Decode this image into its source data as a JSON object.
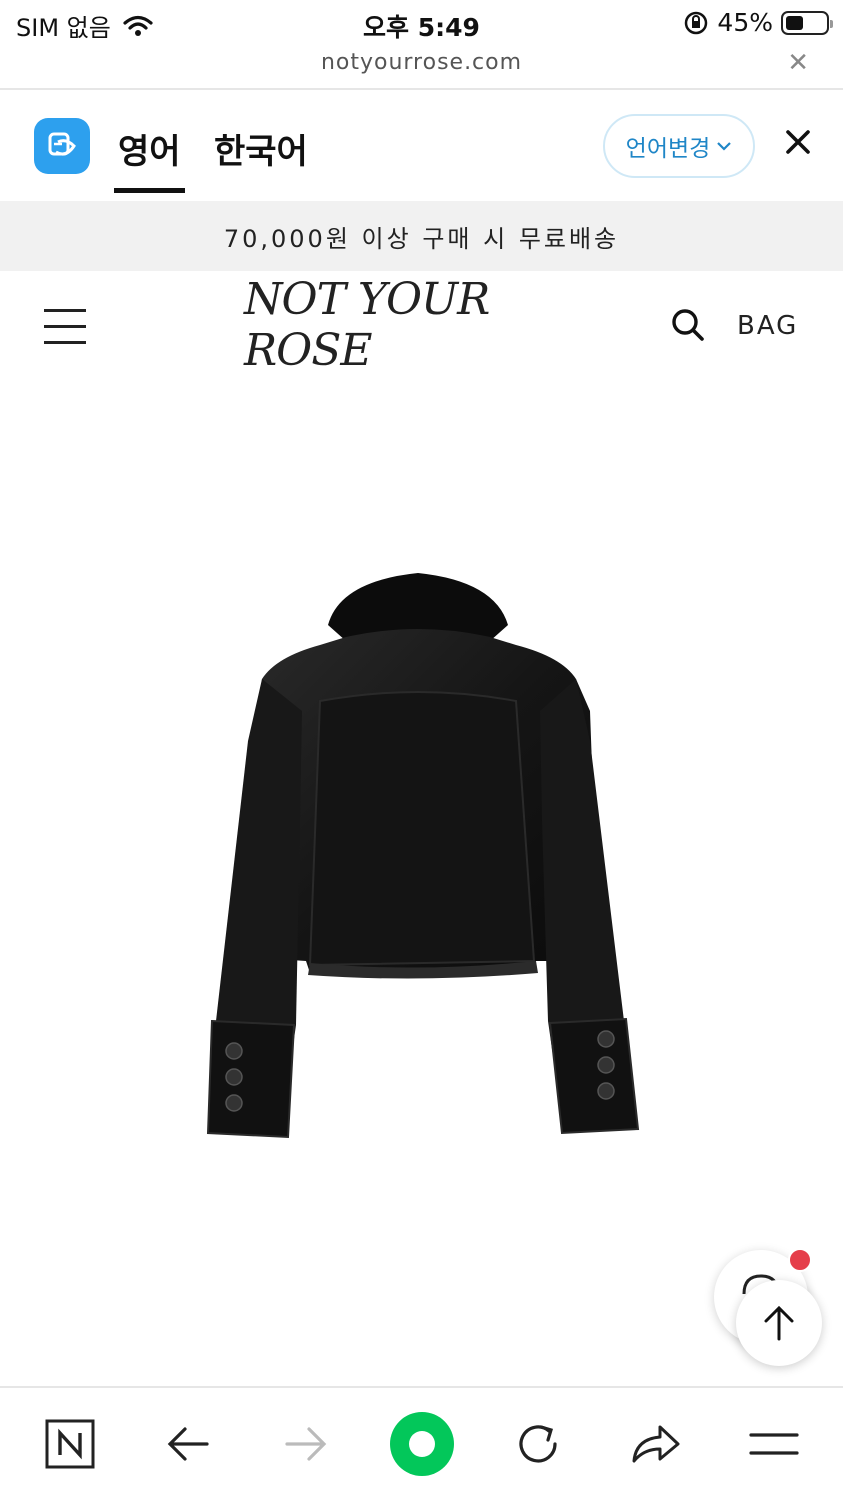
{
  "status_bar": {
    "carrier": "SIM 없음",
    "time": "오후 5:49",
    "battery_percent": "45%",
    "battery_level": 0.45
  },
  "url_bar": {
    "domain": "notyourrose.com"
  },
  "translate_bar": {
    "tabs": [
      {
        "label": "영어",
        "active": true
      },
      {
        "label": "한국어",
        "active": false
      }
    ],
    "change_language_label": "언어변경"
  },
  "promo": {
    "text": "70,000원 이상 구매 시 무료배송"
  },
  "site_header": {
    "brand": "NOT YOUR ROSE",
    "bag_label": "BAG"
  },
  "colors": {
    "accent_blue": "#1f86c7",
    "logo_blue": "#2da0ee",
    "notification_red": "#e53e4a",
    "naver_green": "#03c75a"
  },
  "icons": {
    "wifi": "wifi-icon",
    "lock_rotation": "rotation-lock-icon",
    "search": "search-icon",
    "menu": "hamburger-icon",
    "back": "arrow-left-icon",
    "forward": "arrow-right-icon",
    "reload": "reload-icon",
    "share": "share-icon"
  }
}
